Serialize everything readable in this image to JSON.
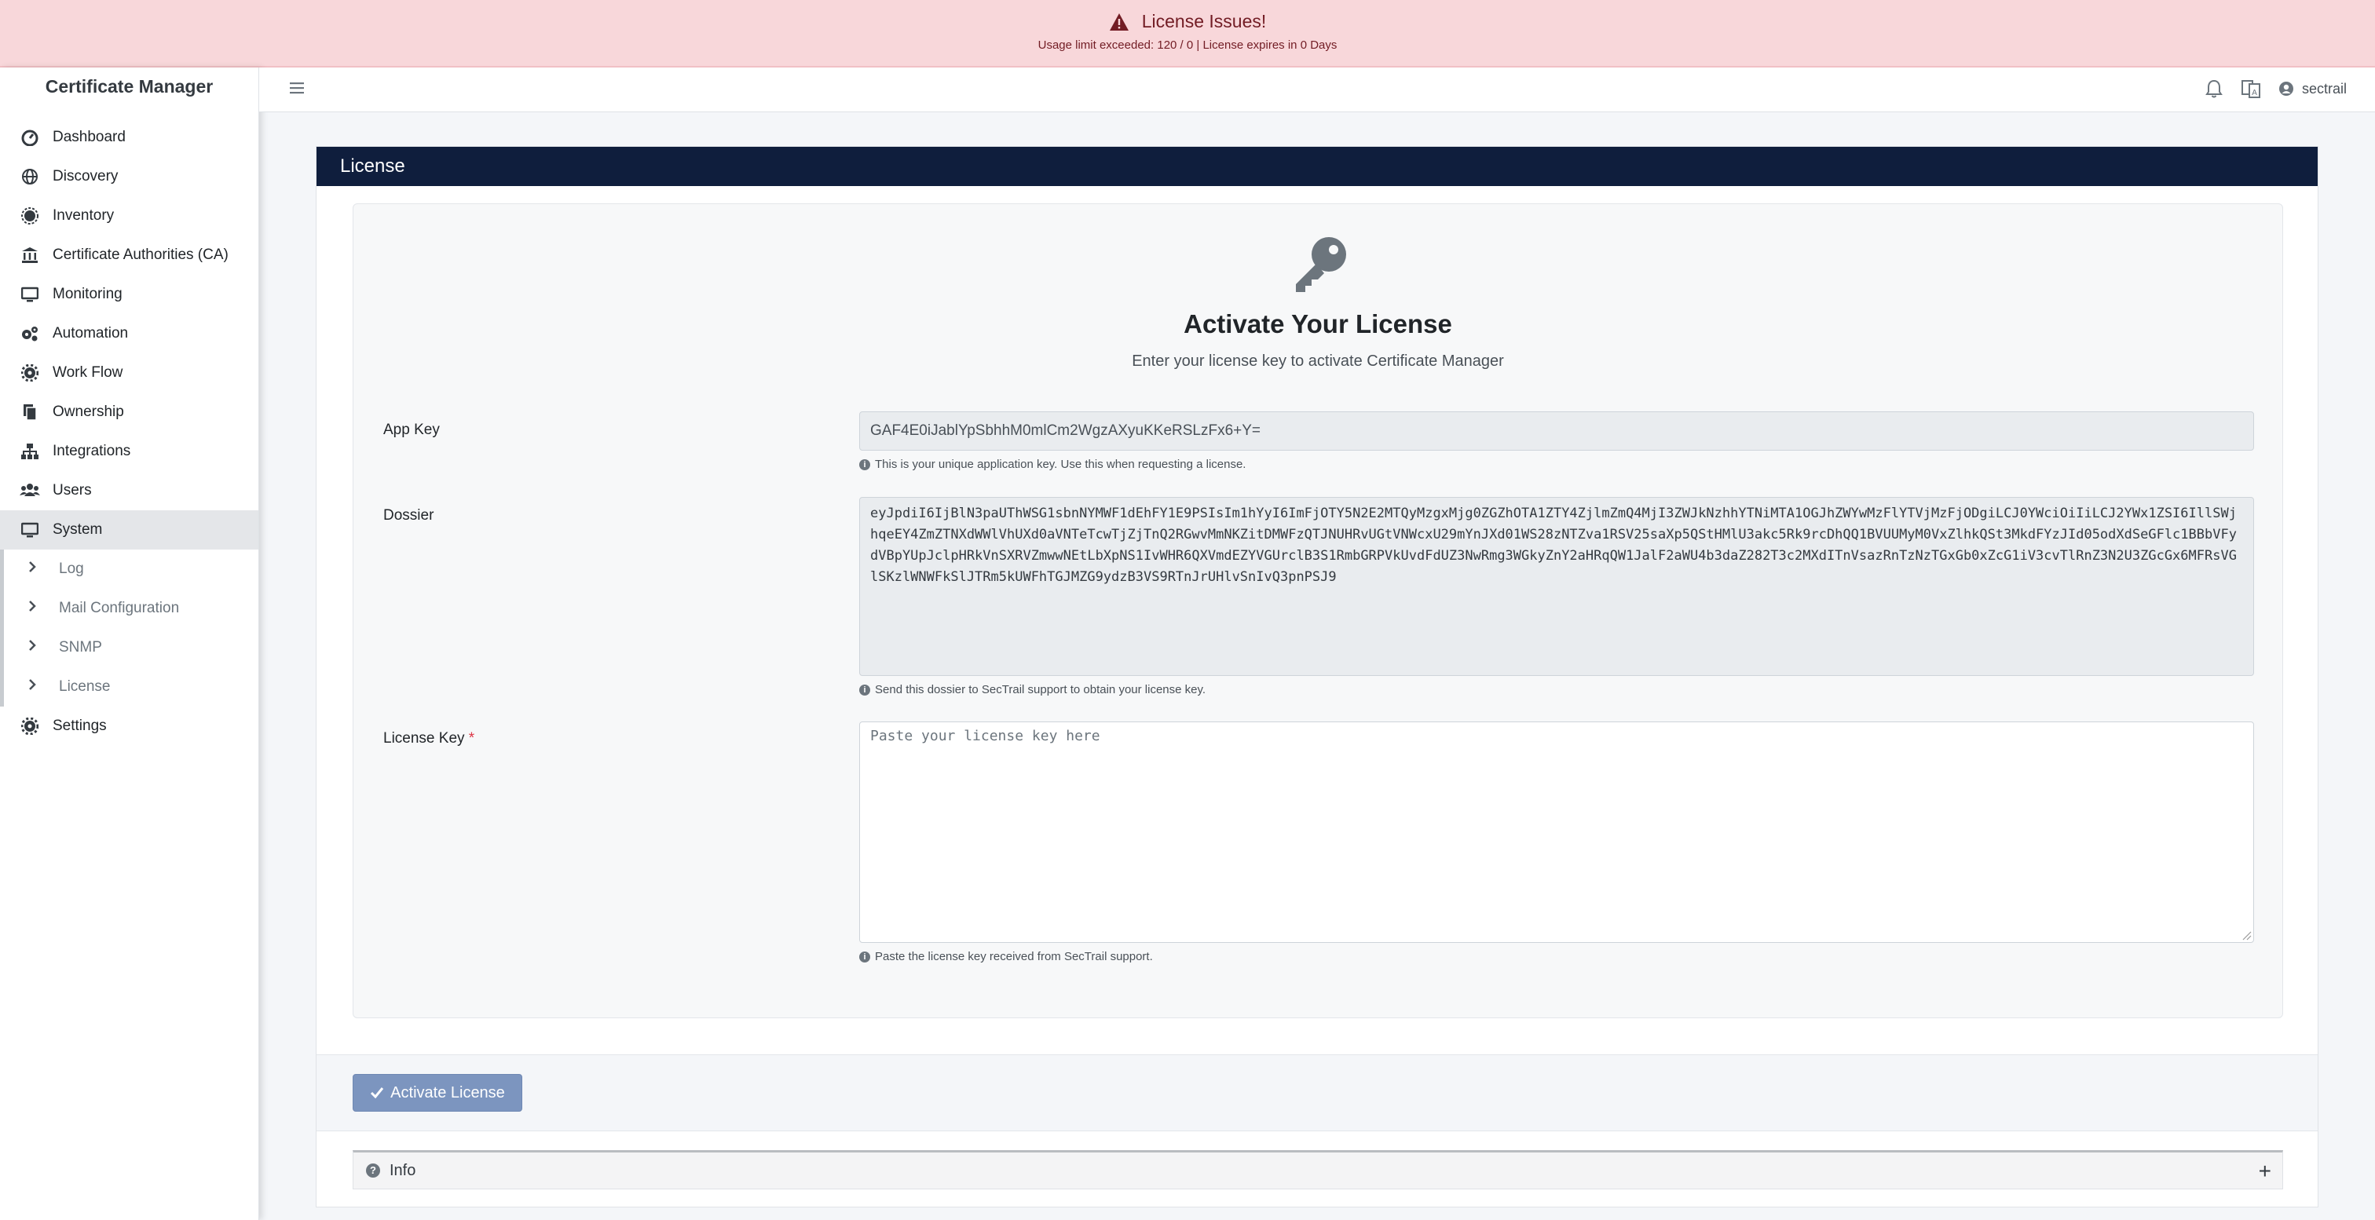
{
  "alert": {
    "title": "License Issues!",
    "message": "Usage limit exceeded: 120 / 0 | License expires in 0 Days"
  },
  "sidebar": {
    "brand": "Certificate Manager",
    "items": [
      {
        "label": "Dashboard",
        "icon": "dashboard-icon"
      },
      {
        "label": "Discovery",
        "icon": "globe-icon"
      },
      {
        "label": "Inventory",
        "icon": "certificate-icon"
      },
      {
        "label": "Certificate Authorities (CA)",
        "icon": "bank-icon"
      },
      {
        "label": "Monitoring",
        "icon": "monitor-icon"
      },
      {
        "label": "Automation",
        "icon": "cogs-icon"
      },
      {
        "label": "Work Flow",
        "icon": "gear-icon"
      },
      {
        "label": "Ownership",
        "icon": "copy-icon"
      },
      {
        "label": "Integrations",
        "icon": "sitemap-icon"
      },
      {
        "label": "Users",
        "icon": "users-icon"
      },
      {
        "label": "System",
        "icon": "monitor-icon"
      },
      {
        "label": "Settings",
        "icon": "gear-icon"
      }
    ],
    "system_sub": [
      {
        "label": "Log"
      },
      {
        "label": "Mail Configuration"
      },
      {
        "label": "SNMP"
      },
      {
        "label": "License"
      }
    ]
  },
  "topbar": {
    "username": "sectrail"
  },
  "card": {
    "header": "License",
    "title": "Activate Your License",
    "subtitle": "Enter your license key to activate Certificate Manager",
    "app_key_label": "App Key",
    "app_key_value": "GAF4E0iJablYpSbhhM0mlCm2WgzAXyuKKeRSLzFx6+Y=",
    "app_key_help": "This is your unique application key. Use this when requesting a license.",
    "dossier_label": "Dossier",
    "dossier_value": "eyJpdiI6IjBlN3paUThWSG1sbnNYMWF1dEhFY1E9PSIsIm1hYyI6ImFjOTY5N2E2MTQyMzgxMjg0ZGZhOTA1ZTY4ZjlmZmQ4MjI3ZWJkNzhhYTNiMTA1OGJhZWYwMzFlYTVjMzFjODgiLCJ0YWciOiIiLCJ2YWx1ZSI6IllSWjhqeEY4ZmZTNXdWWlVhUXd0aVNTeTcwTjZjTnQ2RGwvMmNKZitDMWFzQTJNUHRvUGtVNWcxU29mYnJXd01WS28zNTZva1RSV25saXp5QStHMlU3akc5Rk9rcDhQQ1BVUUMyM0VxZlhkQSt3MkdFYzJId05odXdSeGFlc1BBbVFydVBpYUpJclpHRkVnSXRVZmwwNEtLbXpNS1IvWHR6QXVmdEZYVGUrclB3S1RmbGRPVkUvdFdUZ3NwRmg3WGkyZnY2aHRqQW1JalF2aWU4b3daZ282T3c2MXdITnVsazRnTzNzTGxGb0xZcG1iV3cvTlRnZ3N2U3ZGcGx6MFRsVGlSKzlWNWFkSlJTRm5kUWFhTGJMZG9ydzB3VS9RTnJrUHlvSnIvQ3pnPSJ9",
    "dossier_help": "Send this dossier to SecTrail support to obtain your license key.",
    "license_key_label": "License Key",
    "license_key_required": "*",
    "license_key_placeholder": "Paste your license key here",
    "license_key_value": "",
    "license_key_help": "Paste the license key received from SecTrail support.",
    "activate_button": "Activate License",
    "info_label": "Info",
    "info_toggle": "+"
  }
}
